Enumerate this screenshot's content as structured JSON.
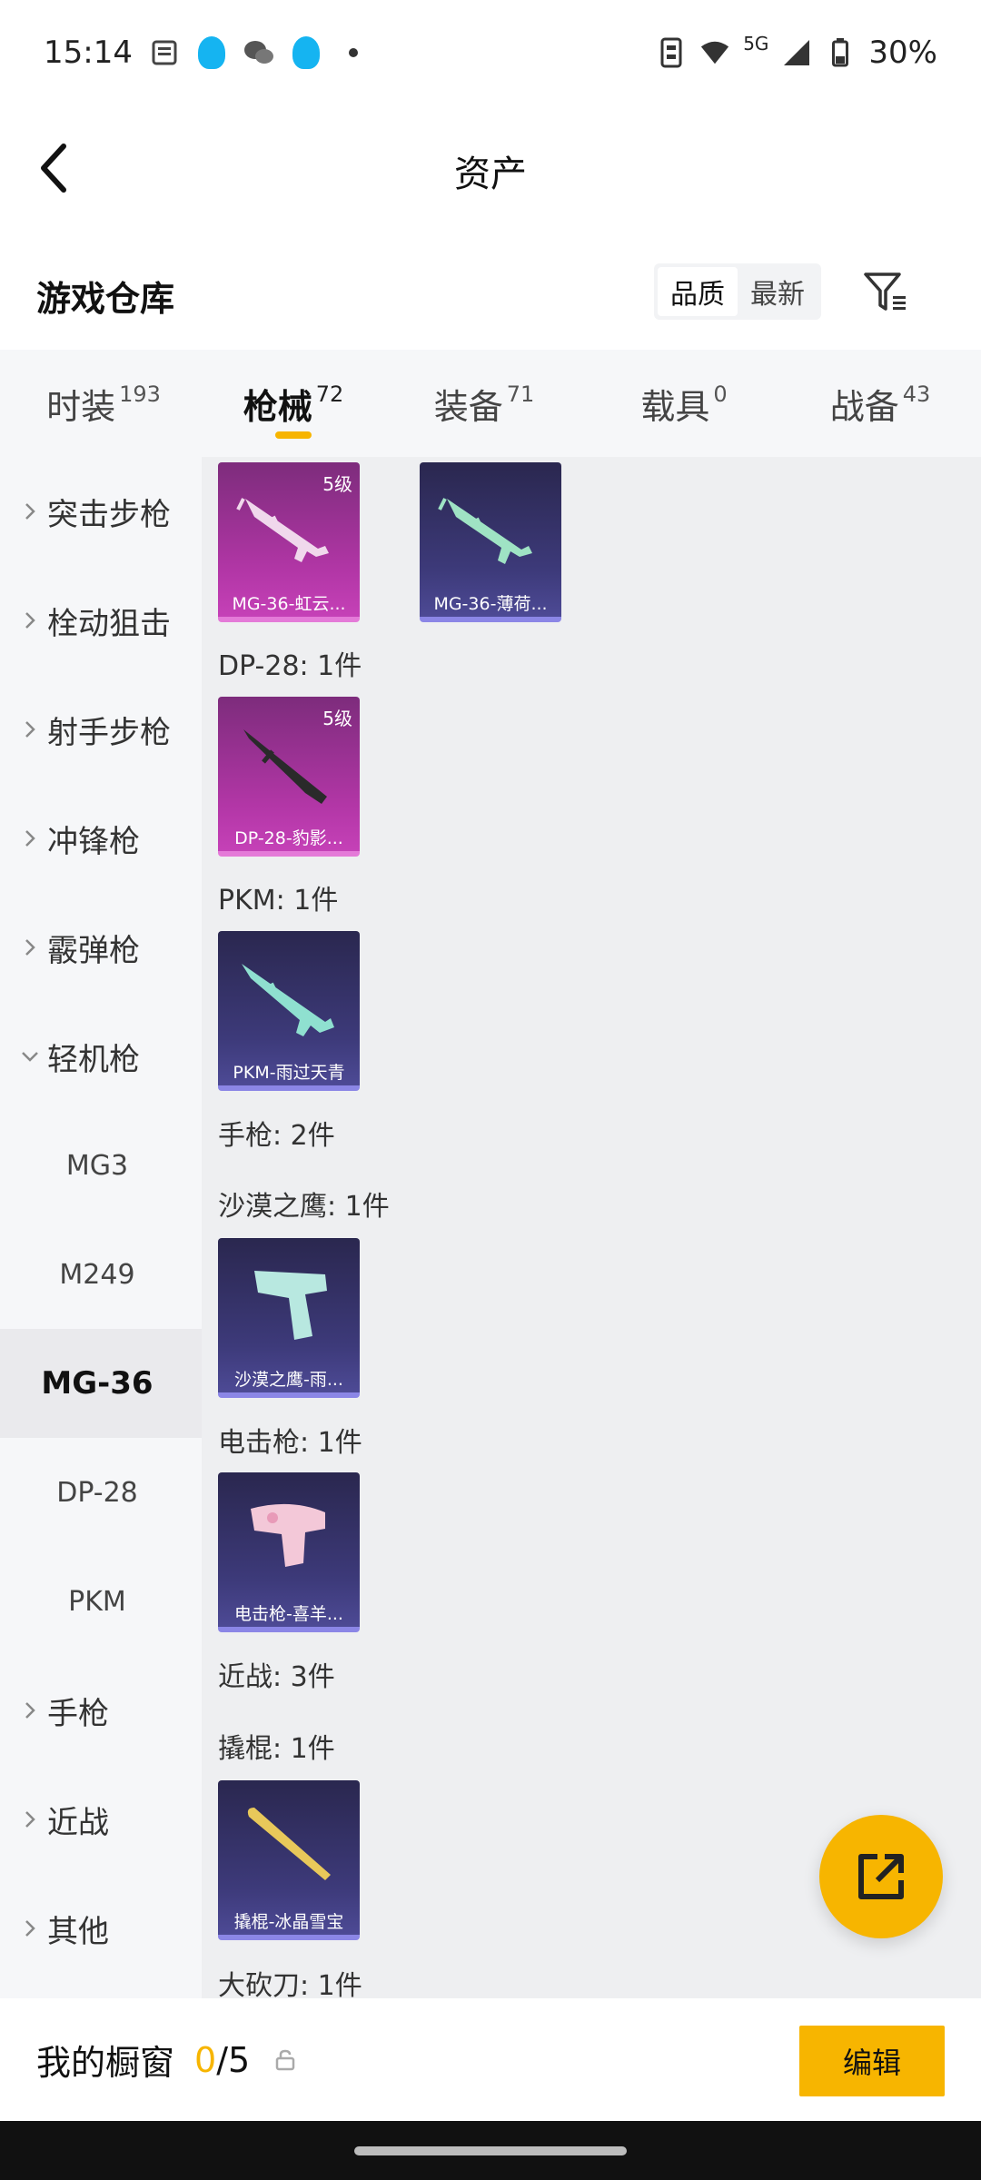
{
  "status_bar": {
    "time": "15:14",
    "network": "5G",
    "battery": "30%"
  },
  "header": {
    "title": "资产"
  },
  "warehouse": {
    "title": "游戏仓库",
    "sort_quality": "品质",
    "sort_newest": "最新"
  },
  "tabs": [
    {
      "label": "时装",
      "count": "193"
    },
    {
      "label": "枪械",
      "count": "72"
    },
    {
      "label": "装备",
      "count": "71"
    },
    {
      "label": "载具",
      "count": "0"
    },
    {
      "label": "战备",
      "count": "43"
    }
  ],
  "sidebar": {
    "categories": [
      "突击步枪",
      "栓动狙击",
      "射手步枪",
      "冲锋枪",
      "霰弹枪",
      "轻机枪"
    ],
    "subitems": [
      "MG3",
      "M249",
      "MG-36",
      "DP-28",
      "PKM"
    ],
    "after": [
      "手枪",
      "近战",
      "其他"
    ]
  },
  "content": {
    "cards_top": [
      {
        "name": "MG-36-虹云...",
        "level": "5级",
        "rarity": "pink"
      },
      {
        "name": "MG-36-薄荷...",
        "rarity": "purple"
      }
    ],
    "groups": [
      {
        "label": "DP-28: 1件"
      },
      {
        "label": "PKM: 1件"
      },
      {
        "label": "手枪: 2件"
      },
      {
        "label": "沙漠之鹰: 1件"
      },
      {
        "label": "电击枪: 1件"
      },
      {
        "label": "近战: 3件"
      },
      {
        "label": "撬棍: 1件"
      },
      {
        "label": "大砍刀: 1件"
      }
    ],
    "cards": [
      {
        "name": "DP-28-豹影...",
        "level": "5级",
        "rarity": "pink"
      },
      {
        "name": "PKM-雨过天青",
        "rarity": "purple"
      },
      {
        "name": "沙漠之鹰-雨...",
        "rarity": "purple"
      },
      {
        "name": "电击枪-喜羊...",
        "rarity": "purple"
      },
      {
        "name": "撬棍-冰晶雪宝",
        "rarity": "purple"
      }
    ]
  },
  "bottom_bar": {
    "title": "我的橱窗",
    "current": "0",
    "total": "/5",
    "edit_label": "编辑"
  },
  "colors": {
    "accent": "#f7b500",
    "pink_card": "#b236a6",
    "purple_card": "#3d3a7a"
  }
}
